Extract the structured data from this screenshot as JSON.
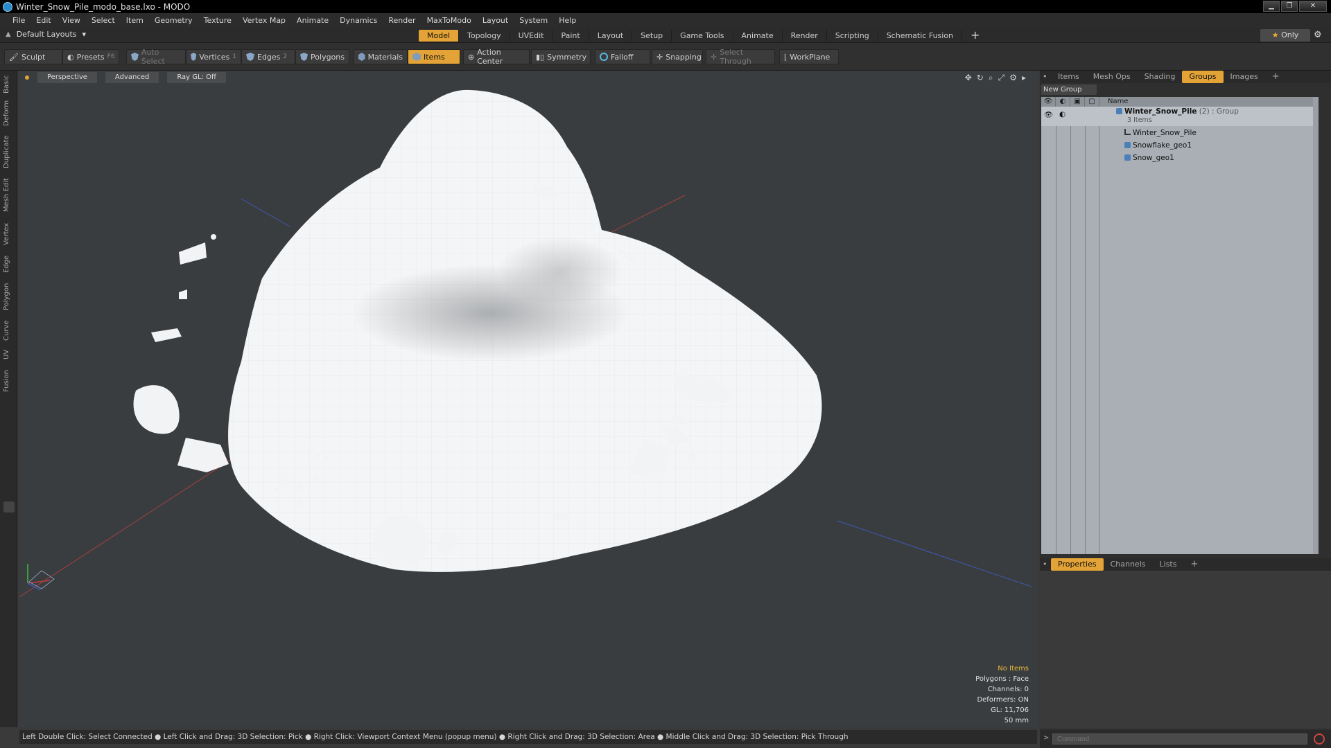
{
  "window": {
    "title": "Winter_Snow_Pile_modo_base.lxo - MODO"
  },
  "menu": [
    "File",
    "Edit",
    "View",
    "Select",
    "Item",
    "Geometry",
    "Texture",
    "Vertex Map",
    "Animate",
    "Dynamics",
    "Render",
    "MaxToModo",
    "Layout",
    "System",
    "Help"
  ],
  "layout_selector": "Default Layouts",
  "mode_tabs": [
    "Model",
    "Topology",
    "UVEdit",
    "Paint",
    "Layout",
    "Setup",
    "Game Tools",
    "Animate",
    "Render",
    "Scripting",
    "Schematic Fusion"
  ],
  "active_mode": "Model",
  "only_label": "Only",
  "toolbar": {
    "sculpt": "Sculpt",
    "presets": "Presets",
    "presets_key": "F6",
    "auto_select": "Auto Select",
    "vertices": "Vertices",
    "vertices_key": "1",
    "edges": "Edges",
    "edges_key": "2",
    "polygons": "Polygons",
    "materials": "Materials",
    "items": "Items",
    "action_center": "Action Center",
    "symmetry": "Symmetry",
    "falloff": "Falloff",
    "snapping": "Snapping",
    "select_through": "Select Through",
    "workplane": "WorkPlane"
  },
  "left_tabs": [
    "Basic",
    "Deform",
    "Duplicate",
    "Mesh Edit",
    "Vertex",
    "Edge",
    "Polygon",
    "Curve",
    "UV",
    "Fusion"
  ],
  "viewport": {
    "perspective": "Perspective",
    "advanced": "Advanced",
    "raygl": "Ray GL: Off",
    "stats": {
      "items": "No Items",
      "polygons": "Polygons : Face",
      "channels": "Channels: 0",
      "deformers": "Deformers: ON",
      "gl": "GL: 11,706",
      "size": "50 mm"
    }
  },
  "status_text": "Left Double Click: Select Connected ● Left Click and Drag: 3D Selection: Pick ● Right Click: Viewport Context Menu (popup menu) ● Right Click and Drag: 3D Selection: Area ● Middle Click and Drag: 3D Selection: Pick Through",
  "right_panel": {
    "tabs": [
      "Items",
      "Mesh Ops",
      "Shading",
      "Groups",
      "Images"
    ],
    "active_tab": "Groups",
    "new_group": "New Group",
    "name_header": "Name",
    "group": {
      "name": "Winter_Snow_Pile",
      "count": "(2)",
      "type": ": Group",
      "items_count": "3 Items"
    },
    "children": [
      "Winter_Snow_Pile",
      "Snowflake_geo1",
      "Snow_geo1"
    ],
    "bottom_tabs": [
      "Properties",
      "Channels",
      "Lists"
    ],
    "bottom_active": "Properties",
    "command_placeholder": "Command"
  },
  "colors": {
    "accent": "#e3a336",
    "viewport_bg": "#3a3d40",
    "snow": "#f4f5f6"
  }
}
